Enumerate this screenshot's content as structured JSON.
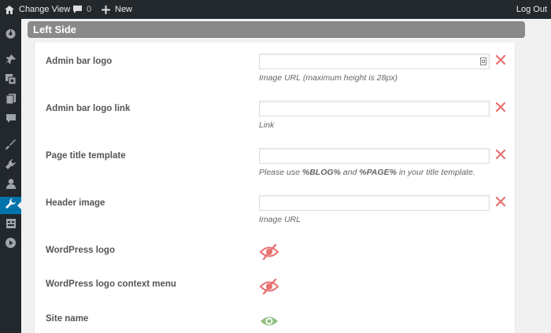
{
  "admin_bar": {
    "site_name": "Change View",
    "comments_count": "0",
    "new_label": "New",
    "logout_label": "Log Out"
  },
  "admin_menu": {
    "icons": [
      "dashboard-icon",
      "pin-icon",
      "media-icon",
      "pages-icon",
      "comments-icon",
      "appearance-icon",
      "plugins-icon",
      "users-icon",
      "tools-icon",
      "settings-icon",
      "play-icon"
    ],
    "active": "tools-icon"
  },
  "section": {
    "title": "Left Side"
  },
  "fields": [
    {
      "label": "Admin bar logo",
      "value": "",
      "hint": "Image URL (maximum height is 28px)"
    },
    {
      "label": "Admin bar logo link",
      "value": "",
      "hint": "Link"
    },
    {
      "label": "Page title template",
      "value": "",
      "hint_before": "Please use ",
      "hint_tag1": "%BLOG%",
      "hint_mid": " and ",
      "hint_tag2": "%PAGE%",
      "hint_after": " in your title template."
    },
    {
      "label": "Header image",
      "value": "",
      "hint": "Image URL"
    }
  ],
  "toggles": [
    {
      "label": "WordPress logo",
      "state": "hidden"
    },
    {
      "label": "WordPress logo context menu",
      "state": "hidden"
    },
    {
      "label": "Site name",
      "state": "visible"
    }
  ],
  "colors": {
    "remove": "#e87171",
    "hidden_eye": "#e87171",
    "visible_eye": "#8fbf7f",
    "active_menu": "#0073aa"
  }
}
